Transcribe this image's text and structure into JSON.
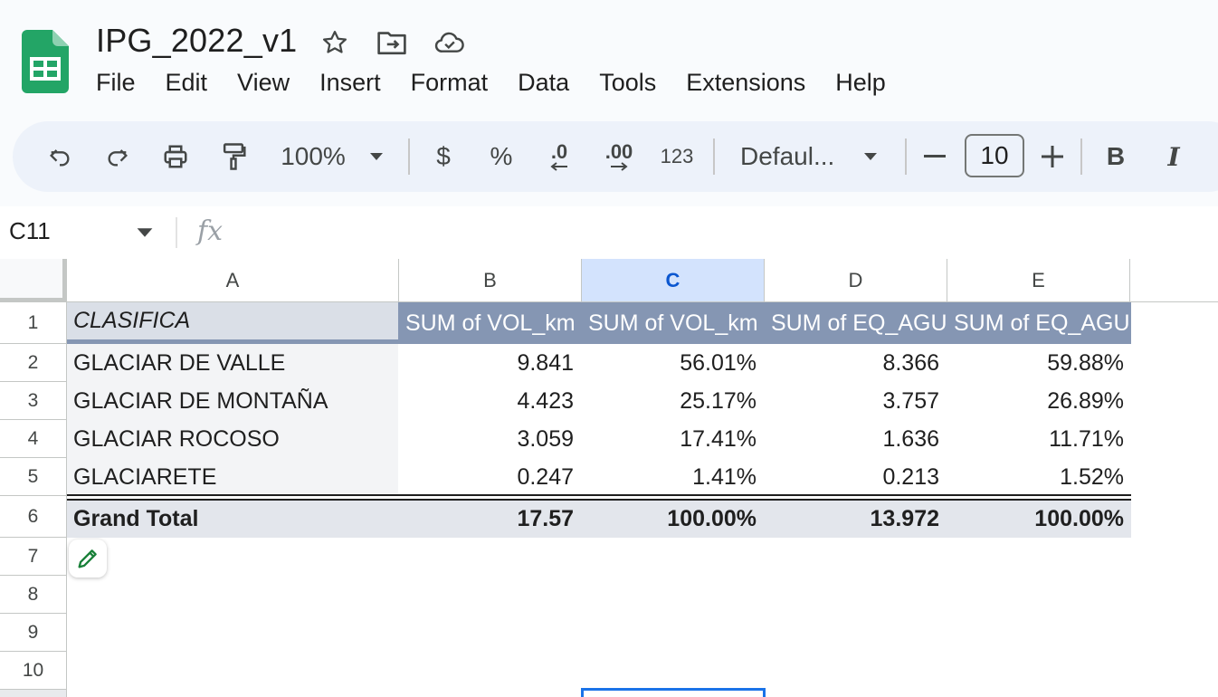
{
  "app": {
    "title": "IPG_2022_v1",
    "title_icons": [
      "star-icon",
      "move-to-folder-icon",
      "cloud-saved-icon"
    ],
    "logo": "google-sheets-logo"
  },
  "menu": [
    "File",
    "Edit",
    "View",
    "Insert",
    "Format",
    "Data",
    "Tools",
    "Extensions",
    "Help"
  ],
  "toolbar": {
    "zoom": "100%",
    "currency": "$",
    "percent": "%",
    "decrease_decimals": ".0",
    "increase_decimals": ".00",
    "more_formats": "123",
    "font": "Defaul...",
    "font_size": "10",
    "bold": "B",
    "italic": "I",
    "icons": [
      "undo-icon",
      "redo-icon",
      "print-icon",
      "paint-format-icon",
      "zoom-dropdown-icon",
      "font-dropdown-icon",
      "minus-icon",
      "plus-icon"
    ]
  },
  "formula_bar": {
    "name_box": "C11",
    "fx": "fx",
    "value": ""
  },
  "sheet": {
    "columns": [
      "A",
      "B",
      "C",
      "D",
      "E",
      ""
    ],
    "selected_column": "C",
    "rows": [
      "1",
      "2",
      "3",
      "4",
      "5",
      "6",
      "7",
      "8",
      "9",
      "10"
    ],
    "header": [
      "CLASIFICA",
      "SUM of VOL_km",
      "SUM of VOL_km",
      "SUM of EQ_AGU",
      "SUM of EQ_AGU"
    ],
    "data": [
      [
        "GLACIAR DE VALLE",
        "9.841",
        "56.01%",
        "8.366",
        "59.88%"
      ],
      [
        "GLACIAR DE MONTAÑA",
        "4.423",
        "25.17%",
        "3.757",
        "26.89%"
      ],
      [
        "GLACIAR ROCOSO",
        "3.059",
        "17.41%",
        "1.636",
        "11.71%"
      ],
      [
        "GLACIARETE",
        "0.247",
        "1.41%",
        "0.213",
        "1.52%"
      ]
    ],
    "total": [
      "Grand Total",
      "17.57",
      "100.00%",
      "13.972",
      "100.00%"
    ],
    "colors": {
      "header_bg": "#8596b3",
      "label_bg": "#f3f4f6",
      "total_bg": "#e3e6ec",
      "selection": "#1a73e8"
    }
  },
  "pivot_edit_icon": "pencil-icon"
}
